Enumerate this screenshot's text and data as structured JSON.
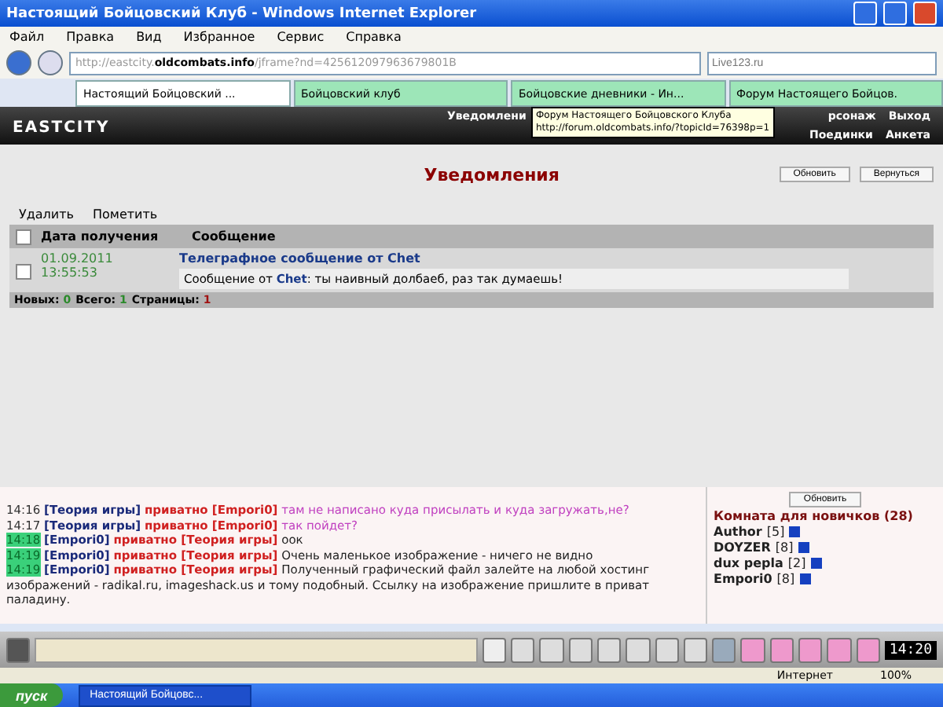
{
  "window": {
    "title": "Настоящий Бойцовский Клуб - Windows Internet Explorer"
  },
  "menu": [
    "Файл",
    "Правка",
    "Вид",
    "Избранное",
    "Сервис",
    "Справка"
  ],
  "address": {
    "prefix": "http://eastcity.",
    "domain": "oldcombats.info",
    "rest": "/jframe?nd=425612097963679801B"
  },
  "search": {
    "placeholder": "Live123.ru"
  },
  "tabs": [
    {
      "label": "Настоящий Бойцовский ...",
      "selected": true
    },
    {
      "label": "Бойцовский клуб",
      "selected": false
    },
    {
      "label": "Бойцовские дневники - Ин...",
      "selected": false
    },
    {
      "label": "Форум Настоящего Бойцов.",
      "selected": false
    }
  ],
  "game": {
    "logo": "EASTCITY",
    "nav_top": [
      "Уведомлени",
      "рсонаж",
      "Выход"
    ],
    "nav_bottom": [
      "Поединки",
      "Анкета"
    ],
    "tooltip": {
      "title": "Форум Настоящего Бойцовского Клуба",
      "url": "http://forum.oldcombats.info/?topicId=76398p=1"
    }
  },
  "notifications": {
    "title": "Уведомления",
    "buttons": [
      "Обновить",
      "Вернуться"
    ],
    "actions": [
      "Удалить",
      "Пометить"
    ],
    "select_all": {
      "checked": false
    },
    "columns": [
      "Дата получения",
      "Сообщение"
    ],
    "rows": [
      {
        "checked": false,
        "date": "01.09.2011 13:55:53",
        "subject": "Телеграфное сообщение от Chet",
        "body_prefix": "Сообщение от ",
        "body_sender": "Chet",
        "body_text": ": ты наивный долбаеб, раз так думаешь!"
      }
    ],
    "footer": [
      {
        "label": "Новых:",
        "value": "0",
        "color": "#2a8a2a"
      },
      {
        "label": "Всего:",
        "value": "1",
        "color": "#2a8a2a"
      },
      {
        "label": "Страницы:",
        "value": "1",
        "color": "#a01010"
      }
    ]
  },
  "chat": [
    {
      "time": "14:16",
      "highlighted": false,
      "from": "[Теория игры]",
      "private": "приватно",
      "to": "[Empori0]",
      "text": "там не написано куда присылать и куда загружать,не?",
      "outgoing": true
    },
    {
      "time": "14:17",
      "highlighted": false,
      "from": "[Теория игры]",
      "private": "приватно",
      "to": "[Empori0]",
      "text": "так пойдет?",
      "outgoing": true
    },
    {
      "time": "14:18",
      "highlighted": true,
      "from": "[Empori0]",
      "private": "приватно",
      "to": "[Теория игры]",
      "text": "оок",
      "outgoing": false
    },
    {
      "time": "14:19",
      "highlighted": true,
      "from": "[Empori0]",
      "private": "приватно",
      "to": "[Теория игры]",
      "text": "Очень маленькое изображение - ничего не видно",
      "outgoing": false
    },
    {
      "time": "14:19",
      "highlighted": true,
      "from": "[Empori0]",
      "private": "приватно",
      "to": "[Теория игры]",
      "text": "Полученный графический файл залейте на любой хостинг изображений - radikal.ru, imageshack.us и тому подобный. Ссылку на изображение пришлите в приват паладину.",
      "outgoing": false
    }
  ],
  "room": {
    "refresh": "Обновить",
    "title": "Комната для новичков (28)",
    "users": [
      {
        "name": "Author",
        "level": "[5]"
      },
      {
        "name": "DOYZER",
        "level": "[8]"
      },
      {
        "name": "dux pepla",
        "level": "[2]"
      },
      {
        "name": "Empori0",
        "level": "[8]"
      }
    ]
  },
  "toolbar": {
    "clock": "14:20"
  },
  "status": {
    "zone": "Интернет",
    "zoom": "100%"
  },
  "taskbar": {
    "start": "пуск",
    "task": "Настоящий Бойцовс..."
  }
}
